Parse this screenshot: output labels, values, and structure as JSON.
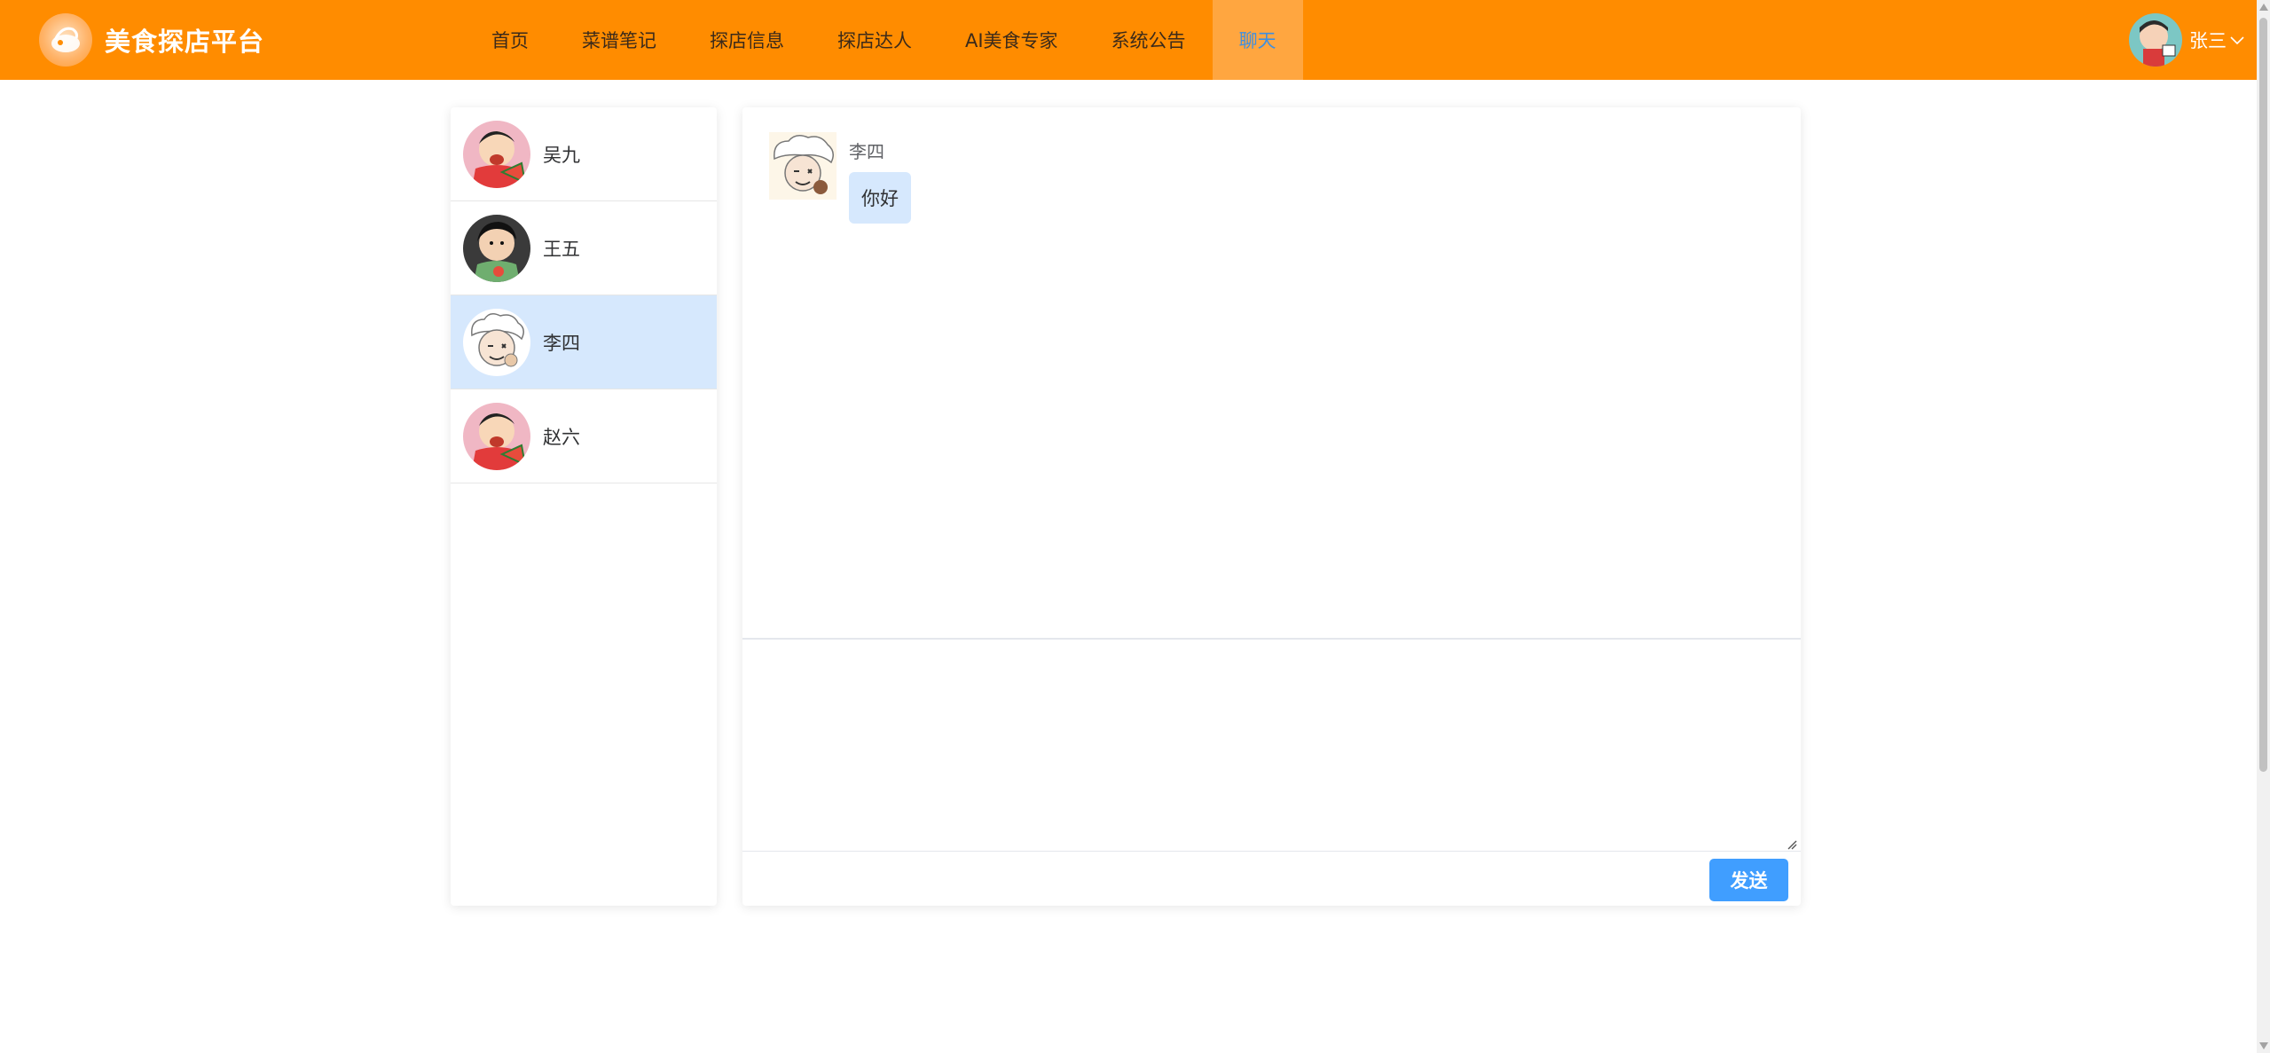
{
  "app": {
    "title": "美食探店平台"
  },
  "nav": {
    "items": [
      {
        "label": "首页"
      },
      {
        "label": "菜谱笔记"
      },
      {
        "label": "探店信息"
      },
      {
        "label": "探店达人"
      },
      {
        "label": "AI美食专家"
      },
      {
        "label": "系统公告"
      },
      {
        "label": "聊天",
        "active": true
      }
    ]
  },
  "user": {
    "name": "张三",
    "icon": "chevron-down-icon"
  },
  "contacts": [
    {
      "name": "吴九",
      "avatar": "shinchan-avatar"
    },
    {
      "name": "王五",
      "avatar": "shinchan-dark-avatar"
    },
    {
      "name": "李四",
      "avatar": "sheep-avatar",
      "active": true
    },
    {
      "name": "赵六",
      "avatar": "shinchan-avatar"
    }
  ],
  "chat": {
    "messages": [
      {
        "sender": "李四",
        "text": "你好"
      }
    ],
    "composer_value": "",
    "send_label": "发送"
  },
  "colors": {
    "header": "#ff8c00",
    "nav_active_bg": "#ffa640",
    "nav_active_text": "#3f8fe0",
    "selected": "#d6e8fd",
    "primary": "#409eff"
  }
}
